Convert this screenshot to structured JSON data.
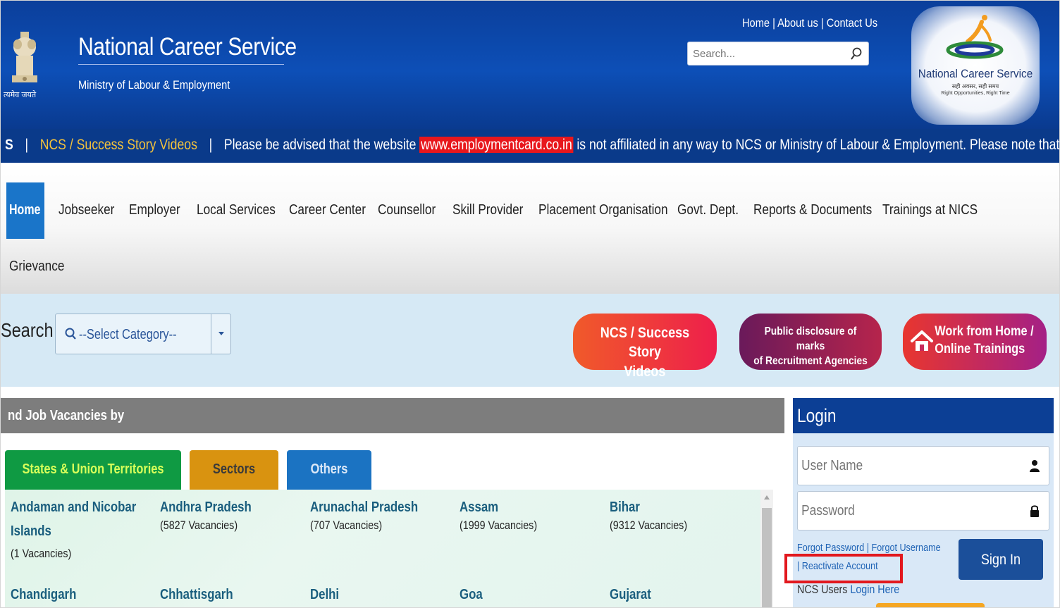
{
  "header": {
    "emblem_text": "त्यमेव जयते",
    "title": "National Career Service",
    "subtitle": "Ministry of Labour & Employment",
    "top_links": [
      "Home",
      "About us",
      "Contact Us"
    ],
    "search_placeholder": "Search...",
    "logo": {
      "name": "National Career Service",
      "hindi": "सही अवसर, सही समय",
      "tagline": "Right Opportunities, Right Time"
    }
  },
  "ticker": {
    "lead": "S",
    "sep1": "|",
    "link": "NCS / Success Story Videos",
    "sep2": "|",
    "before": "Please be advised that the website",
    "highlight": "www.employmentcard.co.in",
    "after": "is not affiliated in any way to NCS or Ministry of Labour & Employment. Please note that NCS does not ch"
  },
  "nav": {
    "items": [
      "Home",
      "Jobseeker",
      "Employer",
      "Local Services",
      "Career Center",
      "Counsellor",
      "Skill Provider",
      "Placement Organisation",
      "Govt. Dept.",
      "Reports & Documents",
      "Trainings at NICS",
      "Grievance"
    ]
  },
  "search_strip": {
    "label": "Search",
    "select_value": "--Select Category--",
    "buttons": {
      "success_videos": [
        "NCS / Success Story",
        "Videos"
      ],
      "disclosure": [
        "Public disclosure of marks",
        "of Recruitment  Agencies"
      ],
      "work_from_home": [
        "Work from Home /",
        "Online Trainings"
      ]
    }
  },
  "vacancies": {
    "header": "nd Job Vacancies by",
    "tabs": [
      "States & Union Territories",
      "Sectors",
      "Others"
    ],
    "states": [
      {
        "name_lines": [
          "Andaman and Nicobar",
          "Islands"
        ],
        "count": "(1 Vacancies)"
      },
      {
        "name_lines": [
          "Andhra Pradesh"
        ],
        "count": "(5827 Vacancies)"
      },
      {
        "name_lines": [
          "Arunachal Pradesh"
        ],
        "count": "(707 Vacancies)"
      },
      {
        "name_lines": [
          "Assam"
        ],
        "count": "(1999 Vacancies)"
      },
      {
        "name_lines": [
          "Bihar"
        ],
        "count": "(9312 Vacancies)"
      },
      {
        "name_lines": [
          "Chandigarh"
        ],
        "count": ""
      },
      {
        "name_lines": [
          "Chhattisgarh"
        ],
        "count": ""
      },
      {
        "name_lines": [
          "Delhi"
        ],
        "count": ""
      },
      {
        "name_lines": [
          "Goa"
        ],
        "count": ""
      },
      {
        "name_lines": [
          "Gujarat"
        ],
        "count": ""
      }
    ]
  },
  "login": {
    "title": "Login",
    "username_placeholder": "User Name",
    "password_placeholder": "Password",
    "forgot_password": "Forgot Password",
    "forgot_username": "Forgot Username",
    "reactivate": "| Reactivate Account",
    "sign_in": "Sign In",
    "ncs_users": "NCS Users",
    "login_here": "Login Here"
  },
  "colors": {
    "header_blue": "#0d4fb7",
    "ticker_blue": "#0a3a8a",
    "nav_active": "#1a75c9",
    "ticker_highlight": "#e8171c",
    "annotation_red": "#e2181e"
  }
}
